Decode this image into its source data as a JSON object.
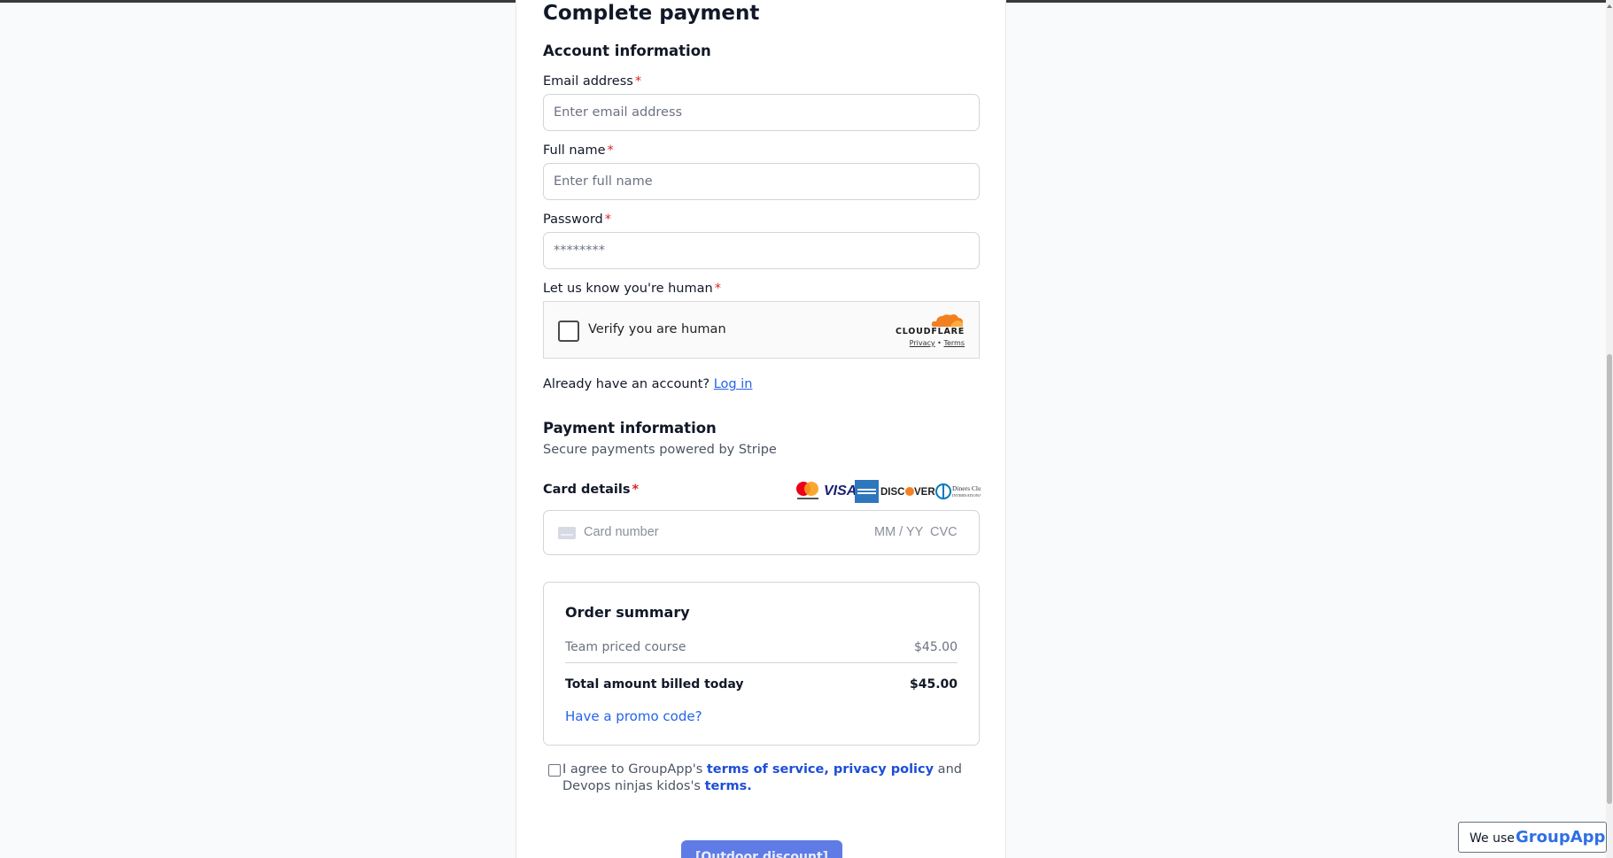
{
  "page": {
    "title": "Complete payment"
  },
  "account": {
    "heading": "Account information",
    "email_label": "Email address",
    "email_placeholder": "Enter email address",
    "name_label": "Full name",
    "name_placeholder": "Enter full name",
    "password_label": "Password",
    "password_placeholder": "********",
    "human_label": "Let us know you're human",
    "required_mark": "*",
    "captcha": {
      "checkbox_label": "Verify you are human",
      "brand": "CLOUDFLARE",
      "privacy": "Privacy",
      "separator": "•",
      "terms": "Terms"
    },
    "login_prompt": "Already have an account?",
    "login_link": "Log in"
  },
  "payment": {
    "heading": "Payment information",
    "subheading": "Secure payments powered by Stripe",
    "card_label": "Card details",
    "card_brands": [
      "Mastercard",
      "VISA",
      "American Express",
      "DISCOVER",
      "Diners Club"
    ],
    "card_number_placeholder": "Card number",
    "expiry_placeholder": "MM / YY",
    "cvc_placeholder": "CVC"
  },
  "summary": {
    "title": "Order summary",
    "item_name": "Team priced course",
    "item_price": "$45.00",
    "total_label": "Total amount billed today",
    "total_price": "$45.00",
    "promo_link": "Have a promo code?"
  },
  "agreement": {
    "prefix": "I agree to GroupApp's ",
    "tos_link": "terms of service, privacy policy",
    "middle": " and Devops ninjas kidos's ",
    "terms_link": "terms."
  },
  "submit_label": "[Outdoor discount]",
  "badge": {
    "prefix": "We use",
    "brand": "GroupApp"
  },
  "colors": {
    "accent": "#2563eb",
    "required": "#dc2626",
    "button": "#5f7be6",
    "cloudflare_orange": "#f38020"
  }
}
